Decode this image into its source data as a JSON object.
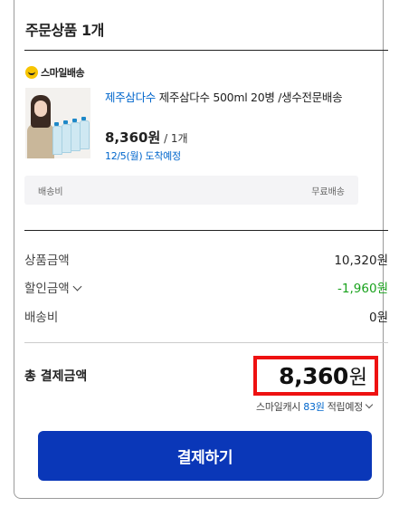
{
  "order": {
    "title": "주문상품 1개",
    "delivery_badge": "스마일배송",
    "product": {
      "brand": "제주삼다수",
      "name": " 제주삼다수 500ml 20병 /생수전문배송",
      "price": "8,360원",
      "qty": " / 1개",
      "arrival": "12/5(월) 도착예정"
    },
    "shipping": {
      "label": "배송비",
      "value": "무료배송"
    }
  },
  "summary": {
    "product_amount_label": "상품금액",
    "product_amount_value": "10,320원",
    "discount_label": "할인금액",
    "discount_value": "-1,960원",
    "shipping_label": "배송비",
    "shipping_value": "0원",
    "total_label": "총 결제금액",
    "total_value": "8,360",
    "total_unit": "원",
    "cash_prefix": "스마일캐시 ",
    "cash_amount": "83원",
    "cash_suffix": " 적립예정"
  },
  "pay_button": "결제하기",
  "colors": {
    "brand_blue": "#0066cc",
    "pay_button": "#0a37b8",
    "discount_green": "#19a21d",
    "highlight_red": "#ee1111",
    "badge_yellow": "#f7c400"
  }
}
